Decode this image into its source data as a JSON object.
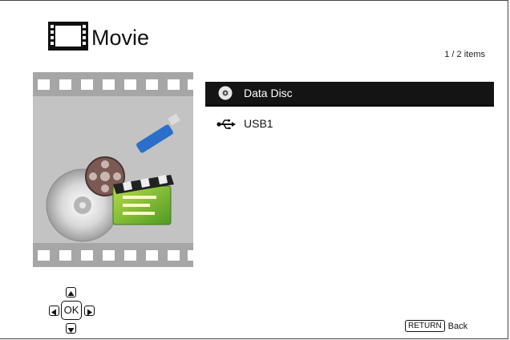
{
  "header": {
    "title": "Movie",
    "icon": "film-icon",
    "item_count": "1 / 2 items"
  },
  "artwork": {
    "description_icon": "media-collage-icon"
  },
  "list": {
    "items": [
      {
        "label": "Data Disc",
        "icon": "disc-icon",
        "selected": true
      },
      {
        "label": "USB1",
        "icon": "usb-icon",
        "selected": false
      }
    ]
  },
  "footer": {
    "nav_ok_label": "OK",
    "return_key_label": "RETURN",
    "return_action_label": "Back"
  },
  "colors": {
    "selected_bg": "#141414",
    "selected_text": "#ffffff",
    "artwork_bg": "#9a9a9a"
  }
}
